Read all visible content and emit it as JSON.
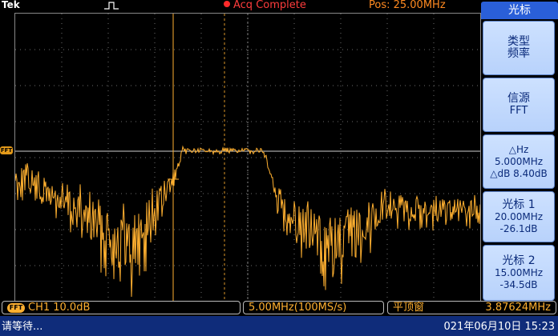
{
  "header": {
    "brand": "Tek",
    "acq_status": "Acq Complete",
    "position": "Pos: 25.00MHz"
  },
  "side_menu": {
    "title": "光标",
    "type_line1": "类型",
    "type_line2": "频率",
    "source_line1": "信源",
    "source_line2": "FFT",
    "delta_line1": "△Hz",
    "delta_line2": "5.000MHz",
    "delta_line3": "△dB 8.40dB",
    "cursor1_line1": "光标 1",
    "cursor1_line2": "20.00MHz",
    "cursor1_line3": "-26.1dB",
    "cursor2_line1": "光标 2",
    "cursor2_line2": "15.00MHz",
    "cursor2_line3": "-34.5dB"
  },
  "status": {
    "fft_badge": "FFT",
    "channel": "CH1  10.0dB",
    "timebase": "5.00MHz(100MS/s)",
    "window": "平顶窗",
    "freq": "3.87624MHz"
  },
  "footer": {
    "message": "请等待...",
    "datetime": "021年06月10日 15:23"
  },
  "display": {
    "fft_marker": "FFT"
  },
  "colors": {
    "trace": "#ffb030",
    "cursor": "#ffb030",
    "grid": "#6e6e6e",
    "menu_title": "#2a5fd8",
    "footer": "#0f2c7a"
  }
}
